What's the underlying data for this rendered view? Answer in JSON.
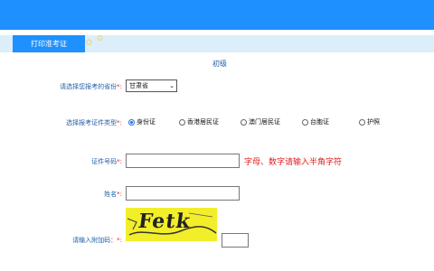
{
  "header": {
    "print_tab_label": "打印准考证"
  },
  "form": {
    "level_title": "初级",
    "province": {
      "label": "请选择您报考的省份",
      "required_mark": "*:",
      "selected": "甘肃省"
    },
    "id_type": {
      "label": "选择报考证件类型",
      "required_mark": "*:",
      "options": [
        "身份证",
        "香港居民证",
        "澳门居民证",
        "台胞证",
        "护照"
      ],
      "selected_index": 0
    },
    "id_number": {
      "label": "证件号码",
      "required_mark": "*:",
      "value": "",
      "hint": "字母、数字请输入半角字符"
    },
    "name": {
      "label": "姓名",
      "required_mark": "*:",
      "value": ""
    },
    "captcha": {
      "label": "请输入附加码",
      "required_mark": "：*:",
      "image_text": "Fetk",
      "value": ""
    }
  },
  "colors": {
    "topbar": "#1e90ff",
    "label_blue": "#1f5fa8",
    "required_red": "#e02020",
    "captcha_bg": "#f3ee2a"
  }
}
